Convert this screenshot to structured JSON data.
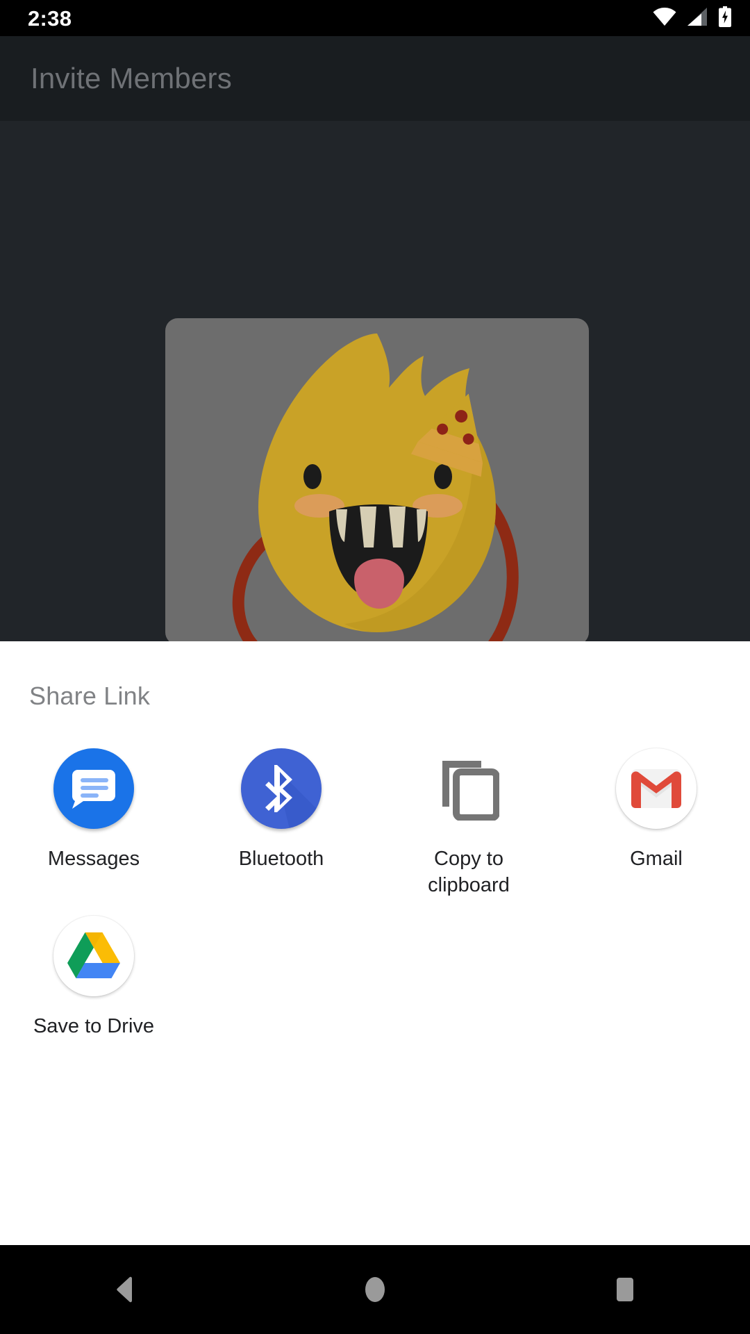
{
  "status_bar": {
    "time": "2:38",
    "icons": [
      {
        "name": "wifi-icon",
        "label": "wifi"
      },
      {
        "name": "cellular-signal-icon",
        "label": "cellular signal"
      },
      {
        "name": "battery-charging-icon",
        "label": "battery charging"
      }
    ]
  },
  "app": {
    "toolbar_title": "Invite Members",
    "card": {
      "name": "monster-illustration-card",
      "background_color": "#6d6d6d",
      "body_color": "#c9a227",
      "mouth_color": "#1b1b1b",
      "tongue_color": "#c9616b",
      "limb_color": "#9c2d16",
      "pizza_crust_color": "#d8a23f",
      "pizza_topping_color": "#8d2317"
    },
    "background_color": "#212529",
    "toolbar_color": "#191d20",
    "title_color": "#6f7276"
  },
  "share_sheet": {
    "title": "Share Link",
    "background_color": "#ffffff",
    "apps": [
      {
        "label": "Messages",
        "icon": "messages-icon",
        "color": "#1a73e8"
      },
      {
        "label": "Bluetooth",
        "icon": "bluetooth-icon",
        "color": "#3f62d3"
      },
      {
        "label": "Copy to\nclipboard",
        "icon": "copy-to-clipboard-icon",
        "color": "#757575"
      },
      {
        "label": "Gmail",
        "icon": "gmail-icon",
        "color": "#d93025"
      },
      {
        "label": "Save to Drive",
        "icon": "google-drive-icon",
        "color": "#0f9d58"
      }
    ]
  },
  "nav_bar": {
    "background_color": "#000000",
    "icon_color": "#9a9a9a",
    "buttons": [
      {
        "name": "back-button",
        "label": "Back"
      },
      {
        "name": "home-button",
        "label": "Home"
      },
      {
        "name": "recents-button",
        "label": "Recents"
      }
    ]
  }
}
